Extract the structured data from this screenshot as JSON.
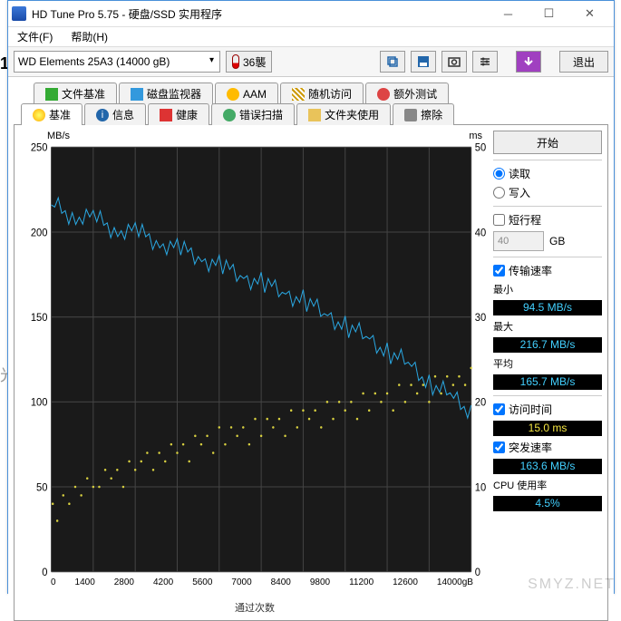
{
  "title": "HD Tune Pro 5.75 - 硬盘/SSD 实用程序",
  "menu": {
    "file": "文件(F)",
    "help": "帮助(H)"
  },
  "drive": "WD    Elements 25A3 (14000 gB)",
  "temperature": "36襲",
  "exit_label": "退出",
  "tabs_row1": [
    {
      "icon": "ti-green",
      "label": "文件基准"
    },
    {
      "icon": "ti-blue",
      "label": "磁盘监视器"
    },
    {
      "icon": "ti-spk",
      "label": "AAM"
    },
    {
      "icon": "ti-rand",
      "label": "随机访问"
    },
    {
      "icon": "ti-extra",
      "label": "额外测试"
    }
  ],
  "tabs_row2": [
    {
      "icon": "ti-bulb",
      "label": "基准",
      "active": true
    },
    {
      "icon": "ti-info",
      "label": "信息"
    },
    {
      "icon": "ti-health",
      "label": "健康"
    },
    {
      "icon": "ti-scan",
      "label": "错误扫描"
    },
    {
      "icon": "ti-folder",
      "label": "文件夹使用"
    },
    {
      "icon": "ti-erase",
      "label": "擦除"
    }
  ],
  "buttons": {
    "start": "开始"
  },
  "options": {
    "read": "读取",
    "write": "写入",
    "short_stroke": "短行程",
    "short_stroke_value": "40",
    "short_stroke_unit": "GB"
  },
  "stats": {
    "transfer_rate": "传输速率",
    "min_label": "最小",
    "min": "94.5 MB/s",
    "max_label": "最大",
    "max": "216.7 MB/s",
    "avg_label": "平均",
    "avg": "165.7 MB/s",
    "access_label": "访问时间",
    "access": "15.0 ms",
    "burst_label": "突发速率",
    "burst": "163.6 MB/s",
    "cpu_label": "CPU 使用率",
    "cpu": "4.5%"
  },
  "chart_data": {
    "type": "combo",
    "y_left_label": "MB/s",
    "y_right_label": "ms",
    "x_unit": "gB",
    "x_max": 14000,
    "y_left_ticks": [
      0,
      50,
      100,
      150,
      200,
      250
    ],
    "y_right_ticks": [
      0,
      10,
      20,
      30,
      40,
      50
    ],
    "x_ticks": [
      0,
      1400,
      2800,
      4200,
      5600,
      7000,
      8400,
      9800,
      11200,
      12600,
      14000
    ],
    "transfer_line": {
      "name": "传输速率 (MB/s)",
      "unit": "MB/s",
      "x": [
        0,
        700,
        1400,
        2100,
        2800,
        3500,
        4200,
        4900,
        5600,
        6300,
        7000,
        7700,
        8400,
        9100,
        9800,
        10500,
        11200,
        11900,
        12600,
        13300,
        14000
      ],
      "y": [
        216,
        210,
        208,
        202,
        200,
        195,
        190,
        186,
        180,
        175,
        170,
        165,
        160,
        152,
        145,
        138,
        130,
        122,
        112,
        103,
        95
      ]
    },
    "access_scatter": {
      "name": "访问时间 (ms)",
      "unit": "ms",
      "points": [
        [
          50,
          8
        ],
        [
          200,
          6
        ],
        [
          400,
          9
        ],
        [
          600,
          8
        ],
        [
          800,
          10
        ],
        [
          1000,
          9
        ],
        [
          1200,
          11
        ],
        [
          1400,
          10
        ],
        [
          1600,
          10
        ],
        [
          1800,
          12
        ],
        [
          2000,
          11
        ],
        [
          2200,
          12
        ],
        [
          2400,
          10
        ],
        [
          2600,
          13
        ],
        [
          2800,
          12
        ],
        [
          3000,
          13
        ],
        [
          3200,
          14
        ],
        [
          3400,
          12
        ],
        [
          3600,
          14
        ],
        [
          3800,
          13
        ],
        [
          4000,
          15
        ],
        [
          4200,
          14
        ],
        [
          4400,
          15
        ],
        [
          4600,
          13
        ],
        [
          4800,
          16
        ],
        [
          5000,
          15
        ],
        [
          5200,
          16
        ],
        [
          5400,
          14
        ],
        [
          5600,
          17
        ],
        [
          5800,
          15
        ],
        [
          6000,
          17
        ],
        [
          6200,
          16
        ],
        [
          6400,
          17
        ],
        [
          6600,
          15
        ],
        [
          6800,
          18
        ],
        [
          7000,
          16
        ],
        [
          7200,
          18
        ],
        [
          7400,
          17
        ],
        [
          7600,
          18
        ],
        [
          7800,
          16
        ],
        [
          8000,
          19
        ],
        [
          8200,
          17
        ],
        [
          8400,
          19
        ],
        [
          8600,
          18
        ],
        [
          8800,
          19
        ],
        [
          9000,
          17
        ],
        [
          9200,
          20
        ],
        [
          9400,
          18
        ],
        [
          9600,
          20
        ],
        [
          9800,
          19
        ],
        [
          10000,
          20
        ],
        [
          10200,
          18
        ],
        [
          10400,
          21
        ],
        [
          10600,
          19
        ],
        [
          10800,
          21
        ],
        [
          11000,
          20
        ],
        [
          11200,
          21
        ],
        [
          11400,
          19
        ],
        [
          11600,
          22
        ],
        [
          11800,
          20
        ],
        [
          12000,
          22
        ],
        [
          12200,
          21
        ],
        [
          12400,
          22
        ],
        [
          12600,
          20
        ],
        [
          12800,
          23
        ],
        [
          13000,
          21
        ],
        [
          13200,
          23
        ],
        [
          13400,
          22
        ],
        [
          13600,
          23
        ],
        [
          13800,
          22
        ],
        [
          14000,
          24
        ]
      ]
    }
  },
  "bottom_note": "通过次数",
  "watermark_sub": "SMYZ.NET"
}
